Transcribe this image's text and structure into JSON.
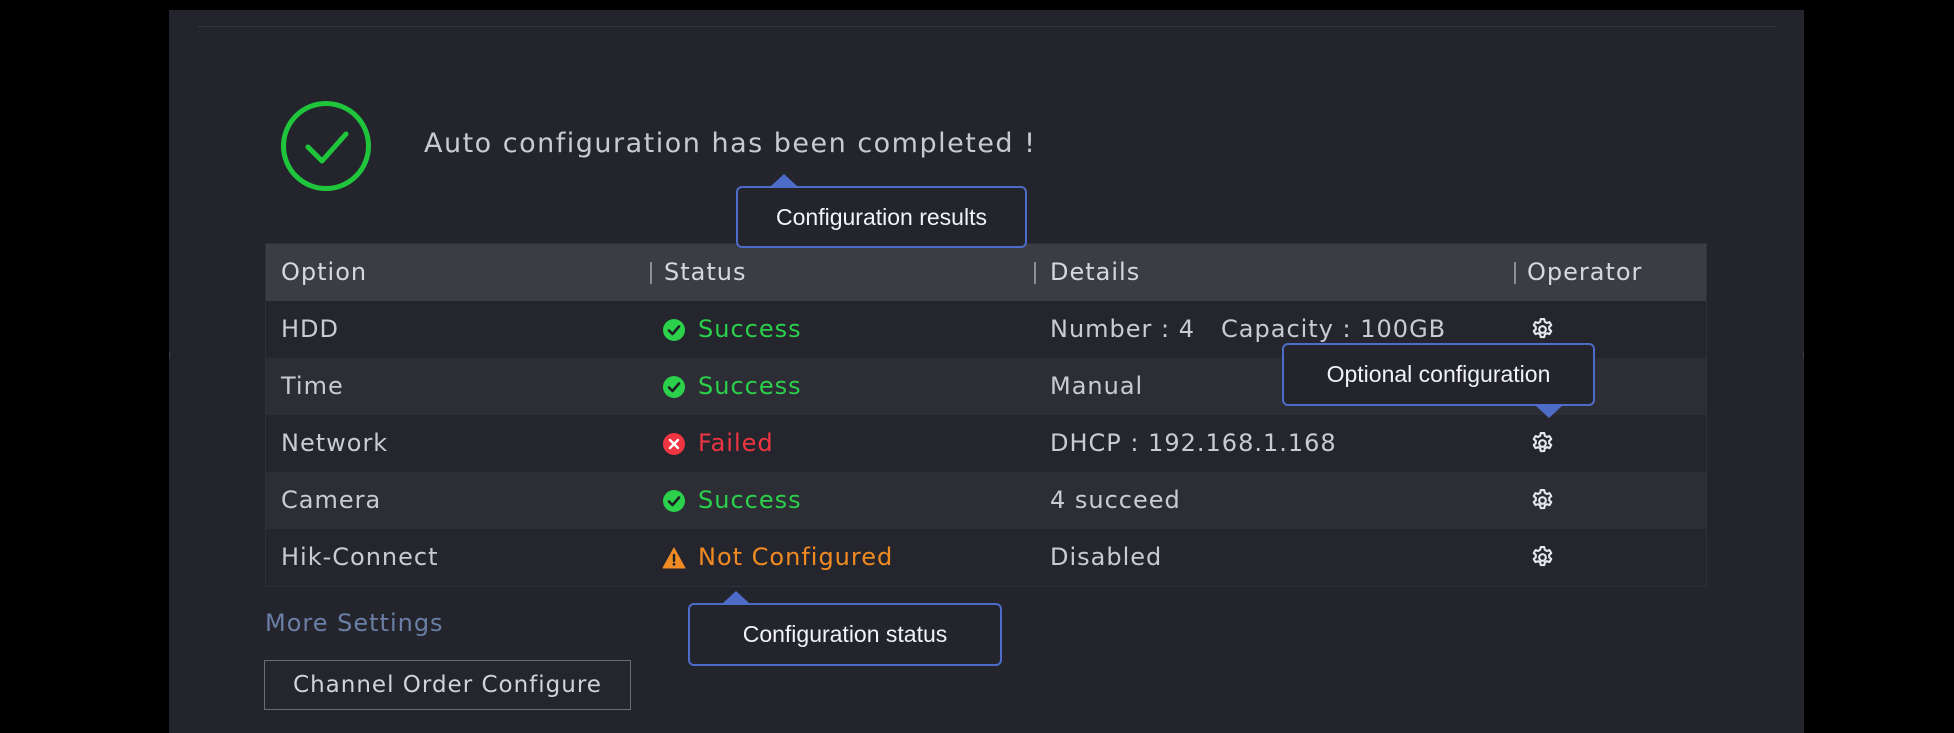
{
  "header": {
    "message": "Auto configuration has been completed !"
  },
  "table": {
    "columns": [
      "Option",
      "Status",
      "Details",
      "Operator"
    ],
    "rows": [
      {
        "option": "HDD",
        "status": "Success",
        "status_type": "success",
        "details_1": "Number : 4",
        "details_2": "Capacity : 100GB",
        "operator_icon": "gear-icon"
      },
      {
        "option": "Time",
        "status": "Success",
        "status_type": "success",
        "details_1": "Manual",
        "details_2": "",
        "operator_icon": "gear-icon"
      },
      {
        "option": "Network",
        "status": "Failed",
        "status_type": "failed",
        "details_1": "DHCP : 192.168.1.168",
        "details_2": "",
        "operator_icon": "gear-icon"
      },
      {
        "option": "Camera",
        "status": "Success",
        "status_type": "success",
        "details_1": "4 succeed",
        "details_2": "",
        "operator_icon": "gear-icon"
      },
      {
        "option": "Hik-Connect",
        "status": "Not Configured",
        "status_type": "warning",
        "details_1": "Disabled",
        "details_2": "",
        "operator_icon": "gear-icon"
      }
    ]
  },
  "links": {
    "more_settings": "More Settings"
  },
  "buttons": {
    "channel_order": "Channel Order Configure"
  },
  "callouts": {
    "results": "Configuration results",
    "optional": "Optional configuration",
    "status": "Configuration status"
  },
  "colors": {
    "success": "#2bd04b",
    "failed": "#ee3541",
    "warning": "#f08a22",
    "callout_border": "#4c6cc7",
    "link": "#6a7fa6"
  },
  "icons": {
    "completed": "check-circle-icon",
    "success": "check-circle-icon",
    "failed": "x-circle-icon",
    "warning": "warning-triangle-icon",
    "operator": "gear-icon"
  }
}
